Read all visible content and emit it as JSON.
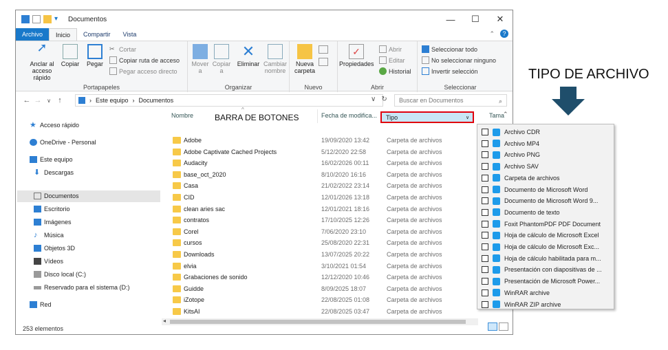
{
  "window": {
    "title": "Documentos",
    "controls": {
      "minimize": "—",
      "maximize": "☐",
      "close": "✕"
    }
  },
  "ribbon_tabs": [
    "Archivo",
    "Inicio",
    "Compartir",
    "Vista"
  ],
  "ribbon": {
    "portapapeles": {
      "label": "Portapapeles",
      "anclar": "Anclar al acceso rápido",
      "copiar": "Copiar",
      "pegar": "Pegar",
      "cortar": "Cortar",
      "copiar_ruta": "Copiar ruta de acceso",
      "pegar_acceso": "Pegar acceso directo"
    },
    "organizar": {
      "label": "Organizar",
      "mover": "Mover a",
      "copiar": "Copiar a",
      "eliminar": "Eliminar",
      "cambiar": "Cambiar nombre"
    },
    "nuevo": {
      "label": "Nuevo",
      "carpeta": "Nueva carpeta"
    },
    "abrir": {
      "label": "Abrir",
      "propiedades": "Propiedades",
      "abrir": "Abrir",
      "editar": "Editar",
      "historial": "Historial"
    },
    "seleccionar": {
      "label": "Seleccionar",
      "todo": "Seleccionar todo",
      "ninguno": "No seleccionar ninguno",
      "invertir": "Invertir selección"
    }
  },
  "address": {
    "path": [
      "Este equipo",
      "Documentos"
    ],
    "search_placeholder": "Buscar en Documentos"
  },
  "nav": [
    {
      "label": "Acceso rápido",
      "icon": "star-icon"
    },
    {
      "label": "OneDrive - Personal",
      "icon": "cloud-icon"
    },
    {
      "label": "Este equipo",
      "icon": "computer-icon"
    },
    {
      "label": "Descargas",
      "icon": "download-icon"
    },
    {
      "label": "Documentos",
      "icon": "documents-icon"
    },
    {
      "label": "Escritorio",
      "icon": "desktop-icon"
    },
    {
      "label": "Imágenes",
      "icon": "pictures-icon"
    },
    {
      "label": "Música",
      "icon": "music-icon"
    },
    {
      "label": "Objetos 3D",
      "icon": "objects3d-icon"
    },
    {
      "label": "Vídeos",
      "icon": "videos-icon"
    },
    {
      "label": "Disco local (C:)",
      "icon": "drive-icon"
    },
    {
      "label": "Reservado para el sistema (D:)",
      "icon": "drive-icon"
    },
    {
      "label": "Red",
      "icon": "network-icon"
    }
  ],
  "columns": {
    "nombre": "Nombre",
    "fecha": "Fecha de modifica...",
    "tipo": "Tipo",
    "tamano": "Tama"
  },
  "files": [
    {
      "name": "Adobe",
      "date": "19/09/2020 13:42",
      "type": "Carpeta de archivos"
    },
    {
      "name": "Adobe Captivate Cached Projects",
      "date": "5/12/2020 22:58",
      "type": "Carpeta de archivos"
    },
    {
      "name": "Audacity",
      "date": "16/02/2026 00:11",
      "type": "Carpeta de archivos"
    },
    {
      "name": "base_oct_2020",
      "date": "8/10/2020 16:16",
      "type": "Carpeta de archivos"
    },
    {
      "name": "Casa",
      "date": "21/02/2022 23:14",
      "type": "Carpeta de archivos"
    },
    {
      "name": "CID",
      "date": "12/01/2026 13:18",
      "type": "Carpeta de archivos"
    },
    {
      "name": "clean aries sac",
      "date": "12/01/2021 18:16",
      "type": "Carpeta de archivos"
    },
    {
      "name": "contratos",
      "date": "17/10/2025 12:26",
      "type": "Carpeta de archivos"
    },
    {
      "name": "Corel",
      "date": "7/06/2020 23:10",
      "type": "Carpeta de archivos"
    },
    {
      "name": "cursos",
      "date": "25/08/2020 22:31",
      "type": "Carpeta de archivos"
    },
    {
      "name": "Downloads",
      "date": "13/07/2025 20:22",
      "type": "Carpeta de archivos"
    },
    {
      "name": "elvia",
      "date": "3/10/2021 01:54",
      "type": "Carpeta de archivos"
    },
    {
      "name": "Grabaciones de sonido",
      "date": "12/12/2020 10:46",
      "type": "Carpeta de archivos"
    },
    {
      "name": "Guidde",
      "date": "8/09/2025 18:07",
      "type": "Carpeta de archivos"
    },
    {
      "name": "iZotope",
      "date": "22/08/2025 01:08",
      "type": "Carpeta de archivos"
    },
    {
      "name": "KitsAI",
      "date": "22/08/2025 03:47",
      "type": "Carpeta de archivos"
    }
  ],
  "status": "253 elementos",
  "type_filter": [
    "Archivo CDR",
    "Archivo MP4",
    "Archivo PNG",
    "Archivo SAV",
    "Carpeta de archivos",
    "Documento de Microsoft Word",
    "Documento de Microsoft Word 9...",
    "Documento de texto",
    "Foxit PhantomPDF PDF Document",
    "Hoja de cálculo de Microsoft Excel",
    "Hoja de cálculo de Microsoft Exc...",
    "Hoja de cálculo habilitada para m...",
    "Presentación con diapositivas de ...",
    "Presentación de Microsoft Power...",
    "WinRAR archive",
    "WinRAR ZIP archive"
  ],
  "annotations": {
    "barra": "BARRA DE BOTONES",
    "tipo": "TIPO DE ARCHIVO"
  },
  "colors": {
    "accent": "#1979ca",
    "highlight": "#c9e6f5",
    "red_box": "#e0000d",
    "arrow": "#1f4e6b"
  }
}
